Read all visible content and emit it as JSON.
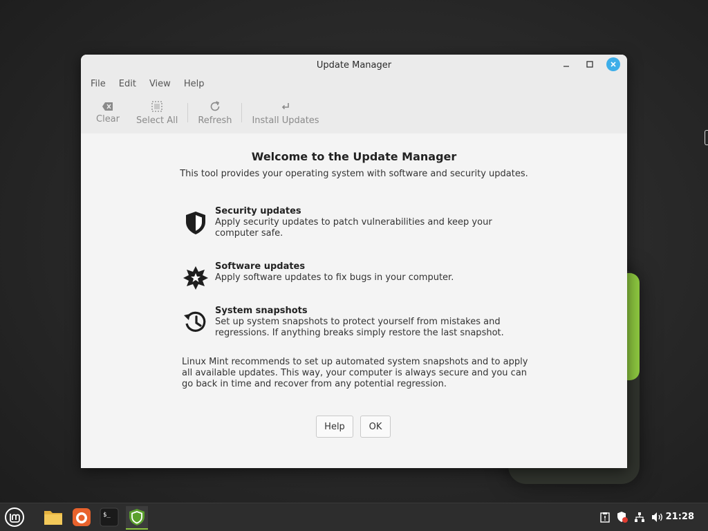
{
  "window": {
    "title": "Update Manager"
  },
  "menubar": {
    "items": [
      "File",
      "Edit",
      "View",
      "Help"
    ]
  },
  "toolbar": {
    "clear": "Clear",
    "select_all": "Select All",
    "refresh": "Refresh",
    "install": "Install Updates"
  },
  "welcome": {
    "title": "Welcome to the Update Manager",
    "subtitle": "This tool provides your operating system with software and security updates.",
    "features": [
      {
        "icon": "shield-icon",
        "title": "Security updates",
        "desc": "Apply security updates to patch vulnerabilities and keep your computer safe."
      },
      {
        "icon": "gear-star-icon",
        "title": "Software updates",
        "desc": "Apply software updates to fix bugs in your computer."
      },
      {
        "icon": "history-icon",
        "title": "System snapshots",
        "desc": "Set up system snapshots to protect yourself from mistakes and regressions. If anything breaks simply restore the last snapshot."
      }
    ],
    "recommendation": "Linux Mint recommends to set up automated system snapshots and to apply all available updates. This way, your computer is always secure and you can go back in time and recover from any potential regression.",
    "help_button": "Help",
    "ok_button": "OK"
  },
  "taskbar": {
    "clock": "21:28",
    "apps": [
      "menu-icon",
      "files-icon",
      "firefox-icon",
      "terminal-icon",
      "update-manager-icon"
    ]
  },
  "colors": {
    "accent": "#8cc63f",
    "close": "#3daee9"
  }
}
